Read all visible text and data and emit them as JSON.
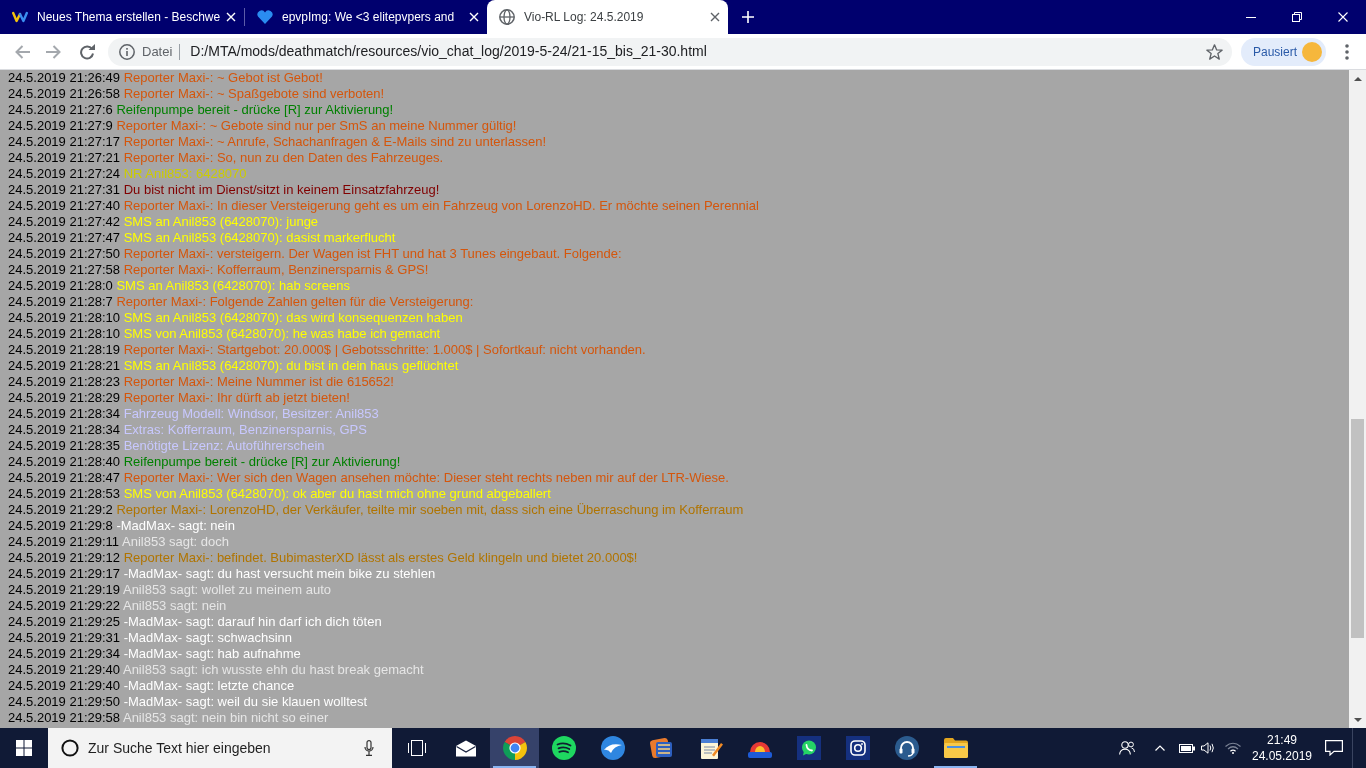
{
  "browser": {
    "tabs": [
      {
        "title": "Neues Thema erstellen - Beschwe",
        "kind": "zigzag",
        "selected": false
      },
      {
        "title": "epvpImg: We <3 elitepvpers and",
        "kind": "heart",
        "selected": false
      },
      {
        "title": "Vio-RL Log: 24.5.2019",
        "kind": "globe",
        "selected": true
      }
    ],
    "address_bar": {
      "security_label": "Datei",
      "url": "D:/MTA/mods/deathmatch/resources/vio_chat_log/2019-5-24/21-15_bis_21-30.html"
    },
    "profile_button": {
      "label": "Pausiert"
    }
  },
  "log": {
    "lines": [
      {
        "time": "24.5.2019 21:26:49",
        "message": "Reporter Maxi-: ~ Gebot ist Gebot!",
        "color": "#d4560c"
      },
      {
        "time": "24.5.2019 21:26:58",
        "message": "Reporter Maxi-: ~ Spaßgebote sind verboten!",
        "color": "#d4560c"
      },
      {
        "time": "24.5.2019 21:27:6",
        "message": "Reifenpumpe bereit - drücke [R] zur Aktivierung!",
        "color": "#008000"
      },
      {
        "time": "24.5.2019 21:27:9",
        "message": "Reporter Maxi-: ~ Gebote sind nur per SmS an meine Nummer gültig!",
        "color": "#d4560c"
      },
      {
        "time": "24.5.2019 21:27:17",
        "message": "Reporter Maxi-: ~ Anrufe, Schachanfragen & E-Mails sind zu unterlassen!",
        "color": "#d4560c"
      },
      {
        "time": "24.5.2019 21:27:21",
        "message": "Reporter Maxi-: So, nun zu den Daten des Fahrzeuges.",
        "color": "#d4560c"
      },
      {
        "time": "24.5.2019 21:27:24",
        "message": "NR Anil853: 6428070",
        "color": "#cccc00"
      },
      {
        "time": "24.5.2019 21:27:31",
        "message": "Du bist nicht im Dienst/sitzt in keinem Einsatzfahrzeug!",
        "color": "#800000"
      },
      {
        "time": "24.5.2019 21:27:40",
        "message": "Reporter Maxi-: In dieser Versteigerung geht es um ein Fahrzeug von LorenzoHD. Er möchte seinen Perennial",
        "color": "#d4560c"
      },
      {
        "time": "24.5.2019 21:27:42",
        "message": "SMS an Anil853 (6428070): junge",
        "color": "#ffff00"
      },
      {
        "time": "24.5.2019 21:27:47",
        "message": "SMS an Anil853 (6428070): dasist markerflucht",
        "color": "#ffff00"
      },
      {
        "time": "24.5.2019 21:27:50",
        "message": "Reporter Maxi-: versteigern. Der Wagen ist FHT und hat 3 Tunes eingebaut. Folgende:",
        "color": "#d4560c"
      },
      {
        "time": "24.5.2019 21:27:58",
        "message": "Reporter Maxi-: Kofferraum, Benzinersparnis & GPS!",
        "color": "#d4560c"
      },
      {
        "time": "24.5.2019 21:28:0",
        "message": "SMS an Anil853 (6428070): hab screens",
        "color": "#ffff00"
      },
      {
        "time": "24.5.2019 21:28:7",
        "message": "Reporter Maxi-: Folgende Zahlen gelten für die Versteigerung:",
        "color": "#d4560c"
      },
      {
        "time": "24.5.2019 21:28:10",
        "message": "SMS an Anil853 (6428070): das wird konsequenzen haben",
        "color": "#ffff00"
      },
      {
        "time": "24.5.2019 21:28:10",
        "message": "SMS von Anil853 (6428070): he was habe ich gemacht",
        "color": "#ffff00"
      },
      {
        "time": "24.5.2019 21:28:19",
        "message": "Reporter Maxi-: Startgebot: 20.000$ | Gebotsschritte: 1.000$ | Sofortkauf: nicht vorhanden.",
        "color": "#d4560c"
      },
      {
        "time": "24.5.2019 21:28:21",
        "message": "SMS an Anil853 (6428070): du bist in dein haus geflüchtet",
        "color": "#ffff00"
      },
      {
        "time": "24.5.2019 21:28:23",
        "message": "Reporter Maxi-: Meine Nummer ist die 615652!",
        "color": "#d4560c"
      },
      {
        "time": "24.5.2019 21:28:29",
        "message": "Reporter Maxi-: Ihr dürft ab jetzt bieten!",
        "color": "#d4560c"
      },
      {
        "time": "24.5.2019 21:28:34",
        "message": "Fahrzeug Modell: Windsor, Besitzer: Anil853",
        "color": "#c8c8ff"
      },
      {
        "time": "24.5.2019 21:28:34",
        "message": "Extras: Kofferraum, Benzinersparnis, GPS",
        "color": "#c8c8ff"
      },
      {
        "time": "24.5.2019 21:28:35",
        "message": "Benötigte Lizenz: Autoführerschein",
        "color": "#c8c8ff"
      },
      {
        "time": "24.5.2019 21:28:40",
        "message": "Reifenpumpe bereit - drücke [R] zur Aktivierung!",
        "color": "#008000"
      },
      {
        "time": "24.5.2019 21:28:47",
        "message": "Reporter Maxi-: Wer sich den Wagen ansehen möchte: Dieser steht rechts neben mir auf der LTR-Wiese.",
        "color": "#d4560c"
      },
      {
        "time": "24.5.2019 21:28:53",
        "message": "SMS von Anil853 (6428070): ok aber du hast mich ohne grund abgeballert",
        "color": "#ffff00"
      },
      {
        "time": "24.5.2019 21:29:2",
        "message": "Reporter Maxi-: LorenzoHD, der Verkäufer, teilte mir soeben mit, dass sich eine Überraschung im Kofferraum",
        "color": "#b07400"
      },
      {
        "time": "24.5.2019 21:29:8",
        "message": "-MadMax- sagt: nein",
        "color": "#ffffff"
      },
      {
        "time": "24.5.2019 21:29:11",
        "message": "Anil853 sagt: doch",
        "color": "#e6e6e6"
      },
      {
        "time": "24.5.2019 21:29:12",
        "message": "Reporter Maxi-: befindet. BubimasterXD lässt als erstes Geld klingeln und bietet 20.000$!",
        "color": "#b07400"
      },
      {
        "time": "24.5.2019 21:29:17",
        "message": "-MadMax- sagt: du hast versucht mein bike zu stehlen",
        "color": "#ffffff"
      },
      {
        "time": "24.5.2019 21:29:19",
        "message": "Anil853 sagt: wollet zu meinem auto",
        "color": "#e6e6e6"
      },
      {
        "time": "24.5.2019 21:29:22",
        "message": "Anil853 sagt: nein",
        "color": "#e6e6e6"
      },
      {
        "time": "24.5.2019 21:29:25",
        "message": "-MadMax- sagt: darauf hin darf ich dich töten",
        "color": "#ffffff"
      },
      {
        "time": "24.5.2019 21:29:31",
        "message": "-MadMax- sagt: schwachsinn",
        "color": "#ffffff"
      },
      {
        "time": "24.5.2019 21:29:34",
        "message": "-MadMax- sagt: hab aufnahme",
        "color": "#ffffff"
      },
      {
        "time": "24.5.2019 21:29:40",
        "message": "Anil853 sagt: ich wusste ehh du hast break gemacht",
        "color": "#e6e6e6"
      },
      {
        "time": "24.5.2019 21:29:40",
        "message": "-MadMax- sagt: letzte chance",
        "color": "#ffffff"
      },
      {
        "time": "24.5.2019 21:29:50",
        "message": "-MadMax- sagt: weil du sie klauen wolltest",
        "color": "#ffffff"
      },
      {
        "time": "24.5.2019 21:29:58",
        "message": "Anil853 sagt: nein bin nicht so einer",
        "color": "#e6e6e6"
      }
    ]
  },
  "taskbar": {
    "search": {
      "placeholder": "Zur Suche Text hier eingeben"
    },
    "apps": [
      {
        "kind": "mail",
        "selected": false,
        "running": false
      },
      {
        "kind": "browser",
        "selected": true,
        "running": true
      },
      {
        "kind": "music",
        "selected": false,
        "running": false
      },
      {
        "kind": "swoosh",
        "selected": false,
        "running": false
      },
      {
        "kind": "film",
        "selected": false,
        "running": false
      },
      {
        "kind": "notepad",
        "selected": false,
        "running": false
      },
      {
        "kind": "dome",
        "selected": false,
        "running": false
      },
      {
        "kind": "chat",
        "selected": false,
        "running": false
      },
      {
        "kind": "camera",
        "selected": false,
        "running": false
      },
      {
        "kind": "headset",
        "selected": false,
        "running": false
      },
      {
        "kind": "folder",
        "selected": false,
        "running": true
      }
    ],
    "clock": {
      "time": "21:49",
      "date": "24.05.2019"
    }
  }
}
